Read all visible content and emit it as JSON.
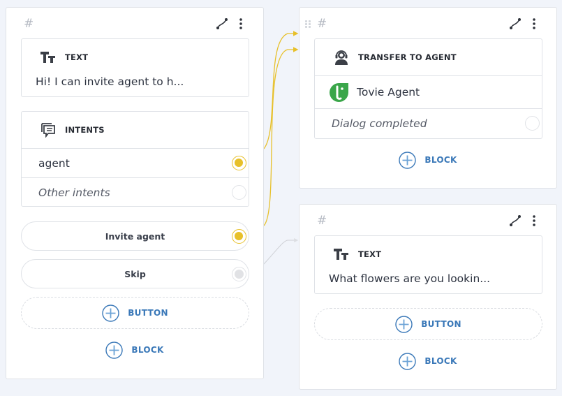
{
  "colors": {
    "background": "#f1f4fa",
    "accent_yellow": "#e7c02a",
    "link_blue": "#3a78b8",
    "tovie_green": "#3aa64a",
    "inactive_connector": "#d6d8dc"
  },
  "cards": {
    "left": {
      "hash": "#",
      "text_block": {
        "icon": "text-format-icon",
        "title": "TEXT",
        "content": "Hi! I can invite agent to h..."
      },
      "intents_block": {
        "icon": "intents-chat-icon",
        "title": "INTENTS",
        "items": [
          {
            "label": "agent",
            "connected": true
          },
          {
            "label": "Other intents",
            "connected": false
          }
        ]
      },
      "buttons": [
        {
          "label": "Invite agent",
          "state": "connected"
        },
        {
          "label": "Skip",
          "state": "disabled"
        }
      ],
      "add_button_label": "BUTTON",
      "add_block_label": "BLOCK"
    },
    "transfer": {
      "hash": "#",
      "block": {
        "icon": "operator-headset-icon",
        "title": "TRANSFER TO AGENT",
        "agent_name": "Tovie Agent",
        "agent_logo": "tovie-logo-icon",
        "status_option": "Dialog completed"
      },
      "add_block_label": "BLOCK"
    },
    "flowers": {
      "hash": "#",
      "text_block": {
        "icon": "text-format-icon",
        "title": "TEXT",
        "content": "What flowers are you lookin..."
      },
      "add_button_label": "BUTTON",
      "add_block_label": "BLOCK"
    }
  }
}
